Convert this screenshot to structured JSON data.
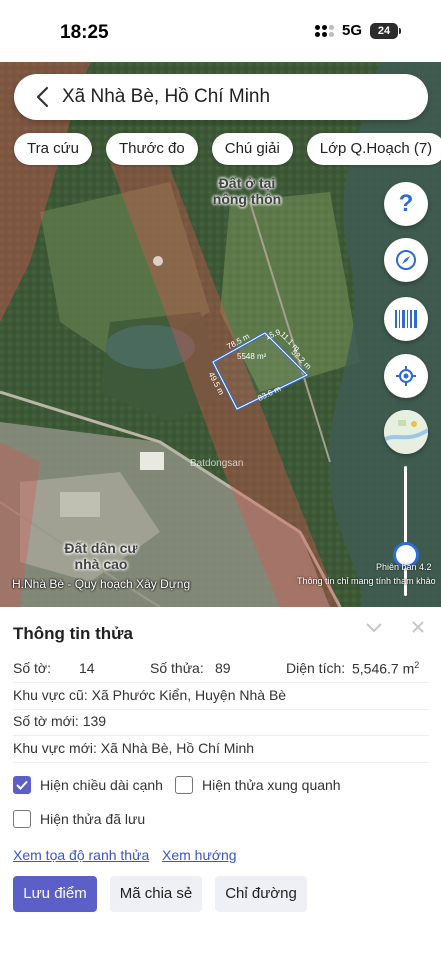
{
  "status_bar": {
    "time": "18:25",
    "network": "5G",
    "battery": "24"
  },
  "search": {
    "text": "Xã Nhà Bè, Hồ Chí Minh"
  },
  "chips": [
    "Tra cứu",
    "Thước đo",
    "Chú giải",
    "Lớp Q.Hoạch (7)"
  ],
  "map": {
    "zone_labels": [
      "Đất ở tại nông thôn",
      "Đất dân cư nhà cao"
    ],
    "parcel": {
      "area": "5548 m²",
      "edges": [
        "78.5 m",
        "15.9",
        "11.1 m",
        "52.2 m",
        "83.6 m",
        "49.5 m"
      ]
    },
    "watermark": "Batdongsan",
    "layer_label": "H.Nhà Bè - Quy hoạch Xây Dựng",
    "version": "Phiên bản 4.2",
    "notice": "Thông tin chỉ mang tính tham khảo",
    "colors": {
      "planning_band": "#d9534f",
      "parcel_outline": "#2d6bd6",
      "accent": "#2d6bd6"
    }
  },
  "panel": {
    "title": "Thông tin thửa",
    "so_to_label": "Số tờ:",
    "so_to_value": "14",
    "so_thua_label": "Số thửa:",
    "so_thua_value": "89",
    "dien_tich_label": "Diện tích:",
    "dien_tich_value": "5,546.7 m",
    "dien_tich_unit_sup": "2",
    "khu_vuc_cu": "Khu vực cũ: Xã Phước Kiển, Huyện Nhà Bè",
    "so_to_moi": "Số tờ mới: 139",
    "khu_vuc_moi": "Khu vực mới: Xã Nhà Bè, Hồ Chí Minh",
    "checkboxes": [
      {
        "label": "Hiện chiều dài cạnh",
        "checked": true
      },
      {
        "label": "Hiện thửa xung quanh",
        "checked": false
      },
      {
        "label": "Hiện thửa đã lưu",
        "checked": false
      }
    ],
    "links": [
      "Xem tọa độ ranh thửa",
      "Xem hướng"
    ],
    "buttons": [
      "Lưu điểm",
      "Mã chia sẻ",
      "Chỉ đường"
    ],
    "primary_color": "#5b5fc7"
  }
}
